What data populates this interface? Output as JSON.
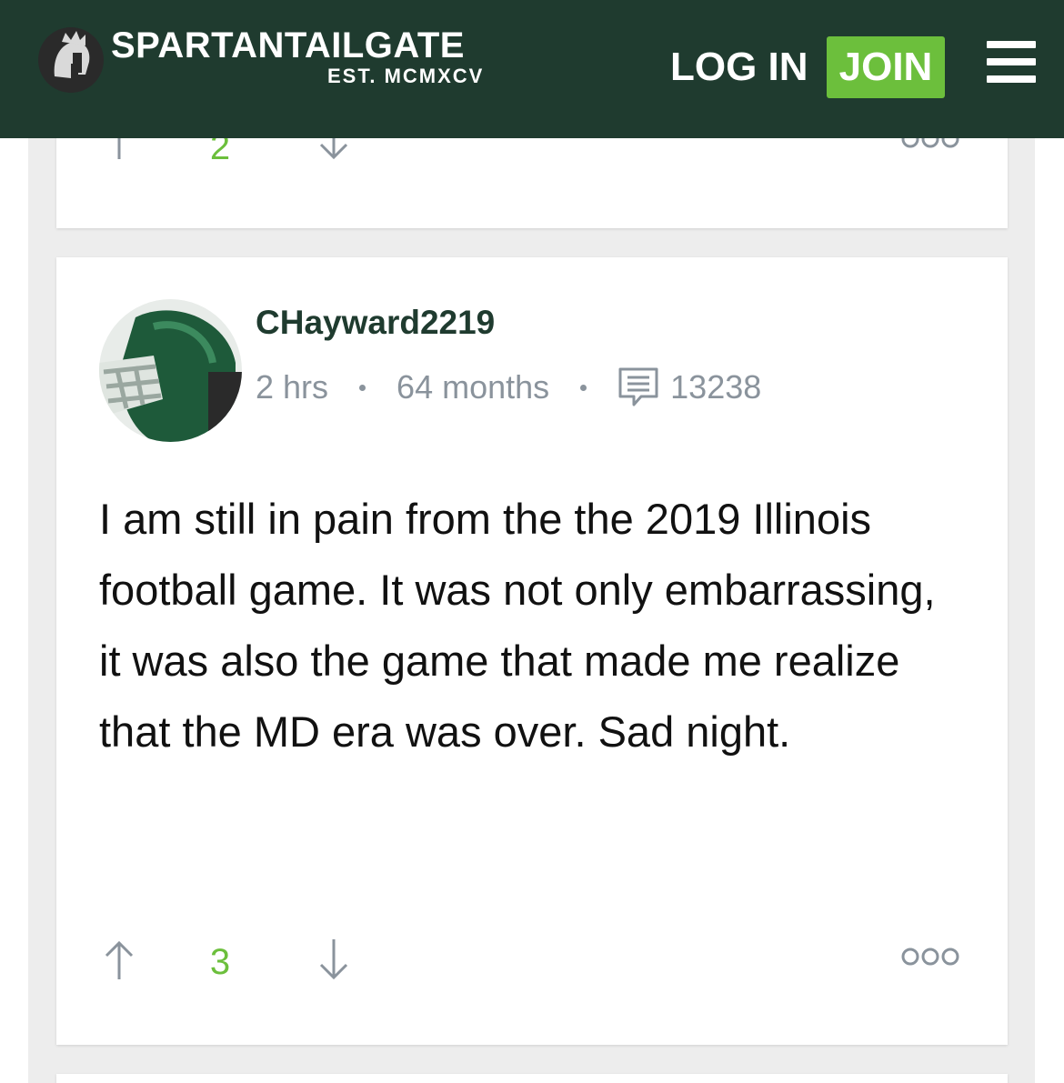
{
  "header": {
    "brand": "SPARTANTAILGATE",
    "brand_sub": "EST. MCMXCV",
    "login_label": "LOG IN",
    "join_label": "JOIN",
    "colors": {
      "bar": "#1f3b2f",
      "join": "#6cbf3c"
    }
  },
  "prev_post": {
    "vote_count": "2"
  },
  "post": {
    "username": "CHayward2219",
    "time_ago": "2 hrs",
    "member_for": "64 months",
    "post_count": "13238",
    "body": "I am still in pain from the the 2019 Illinois football game. It was not only embarrassing, it was also the game that made me realize that the MD era was over. Sad night.",
    "vote_count": "3",
    "avatar_icon": "football-helmet-avatar",
    "colors": {
      "username": "#1f3b2f",
      "meta": "#8a939c",
      "votes": "#6cbf3c"
    }
  }
}
